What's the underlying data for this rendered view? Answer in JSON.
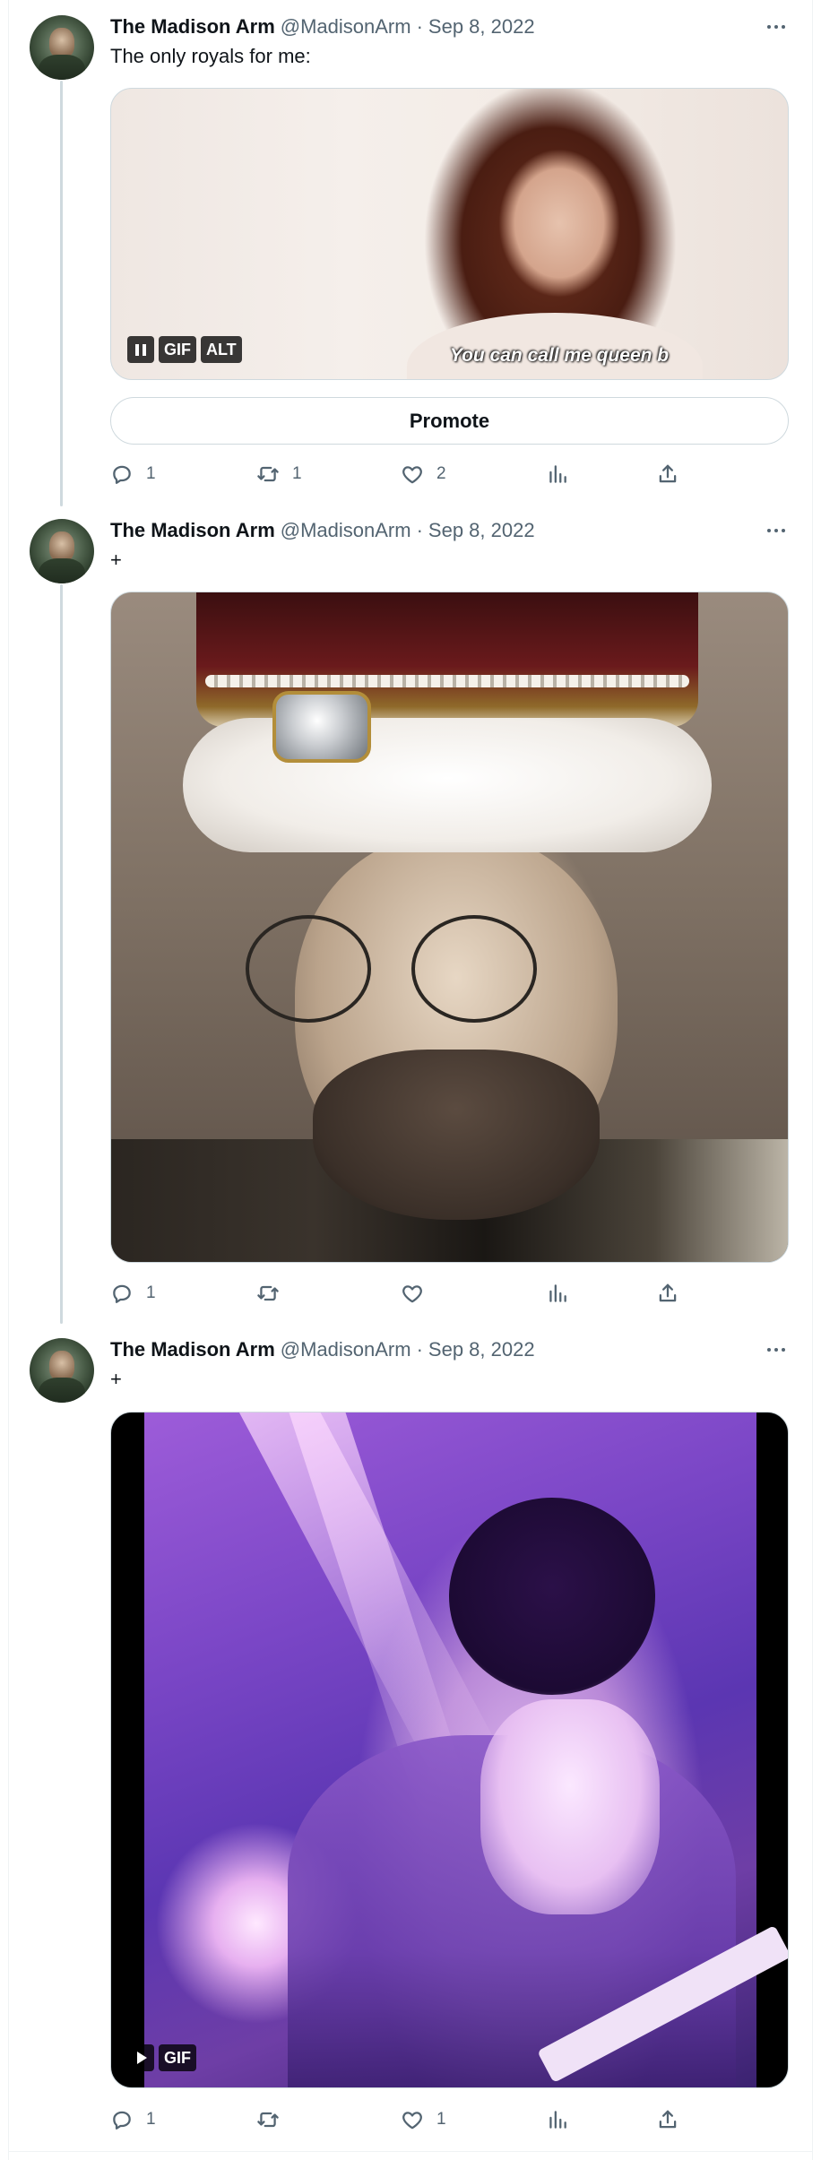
{
  "tweets": [
    {
      "name": "The Madison Arm",
      "handle": "@MadisonArm",
      "separator": "·",
      "date": "Sep 8, 2022",
      "text": "The only royals for me:",
      "media": {
        "kind": "gif",
        "caption": "You can call me queen b",
        "badges": {
          "gif": "GIF",
          "alt": "ALT"
        },
        "state": "playing"
      },
      "promote_label": "Promote",
      "stats": {
        "replies": "1",
        "retweets": "1",
        "likes": "2"
      }
    },
    {
      "name": "The Madison Arm",
      "handle": "@MadisonArm",
      "separator": "·",
      "date": "Sep 8, 2022",
      "text": "+",
      "media": {
        "kind": "image"
      },
      "stats": {
        "replies": "1",
        "retweets": "",
        "likes": ""
      }
    },
    {
      "name": "The Madison Arm",
      "handle": "@MadisonArm",
      "separator": "·",
      "date": "Sep 8, 2022",
      "text": "+",
      "media": {
        "kind": "gif",
        "badges": {
          "gif": "GIF"
        },
        "state": "paused"
      },
      "stats": {
        "replies": "1",
        "retweets": "",
        "likes": "1"
      }
    }
  ],
  "icons": {
    "reply": "reply-icon",
    "retweet": "retweet-icon",
    "like": "like-icon",
    "views": "views-icon",
    "share": "share-icon",
    "more": "more-icon"
  },
  "colors": {
    "text_primary": "#0f1419",
    "text_secondary": "#536471",
    "border": "#cfd9de",
    "thread_line": "#cfd9de"
  }
}
